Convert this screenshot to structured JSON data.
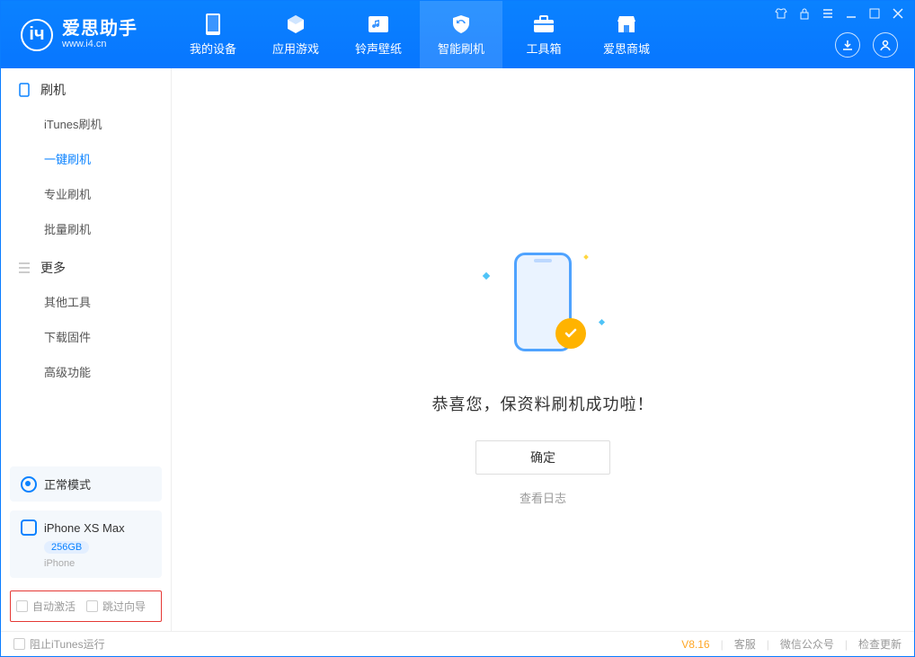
{
  "app": {
    "title": "爱思助手",
    "url": "www.i4.cn"
  },
  "nav": {
    "items": [
      {
        "label": "我的设备"
      },
      {
        "label": "应用游戏"
      },
      {
        "label": "铃声壁纸"
      },
      {
        "label": "智能刷机"
      },
      {
        "label": "工具箱"
      },
      {
        "label": "爱思商城"
      }
    ]
  },
  "sidebar": {
    "section1_title": "刷机",
    "section1_items": [
      "iTunes刷机",
      "一键刷机",
      "专业刷机",
      "批量刷机"
    ],
    "section2_title": "更多",
    "section2_items": [
      "其他工具",
      "下载固件",
      "高级功能"
    ],
    "mode_label": "正常模式",
    "device": {
      "name": "iPhone XS Max",
      "storage": "256GB",
      "type": "iPhone"
    },
    "checkbox1": "自动激活",
    "checkbox2": "跳过向导"
  },
  "main": {
    "success_message": "恭喜您，保资料刷机成功啦！",
    "ok_button": "确定",
    "view_log": "查看日志"
  },
  "footer": {
    "block_itunes": "阻止iTunes运行",
    "version": "V8.16",
    "links": [
      "客服",
      "微信公众号",
      "检查更新"
    ]
  }
}
